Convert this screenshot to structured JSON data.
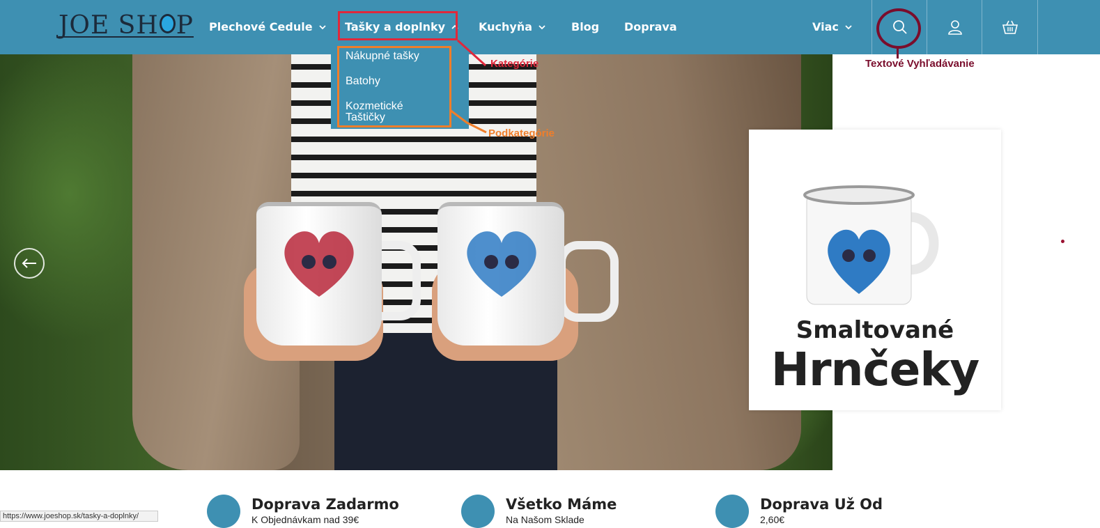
{
  "header": {
    "logo_text_left": "JOE SH",
    "logo_text_right": "P",
    "nav": [
      {
        "label": "Plechové Cedule"
      },
      {
        "label": "Tašky a doplnky"
      },
      {
        "label": "Kuchyňa"
      },
      {
        "label": "Blog"
      },
      {
        "label": "Doprava"
      },
      {
        "label": "Viac"
      }
    ],
    "icons": [
      "search-icon",
      "user-icon",
      "basket-icon"
    ]
  },
  "dropdown": {
    "items": [
      "Nákupné tašky",
      "Batohy",
      "Kozmetické Taštičky"
    ]
  },
  "annotations": {
    "kategorie": "Kategórie",
    "podkategorie": "Podkategórie",
    "search": "Textové Vyhľadávanie",
    "colors": {
      "category": "#e0283b",
      "subcategory": "#f07e2a",
      "search": "#7a0d2c"
    }
  },
  "promo": {
    "line1": "Smaltované",
    "line2": "Hrnčeky"
  },
  "features": [
    {
      "icon": "gift-box-icon",
      "title": "Doprava Zadarmo",
      "subtitle": "K Objednávkam nad 39€"
    },
    {
      "icon": "package-icon",
      "title": "Všetko Máme",
      "subtitle": "Na Našom Sklade"
    },
    {
      "icon": "euro-hand-icon",
      "title": "Doprava Už Od",
      "subtitle": "2,60€"
    }
  ],
  "statusbar": {
    "url": "https://www.joeshop.sk/tasky-a-doplnky/"
  },
  "colors": {
    "header_bg": "#3e90b2",
    "text_dark": "#222222"
  }
}
